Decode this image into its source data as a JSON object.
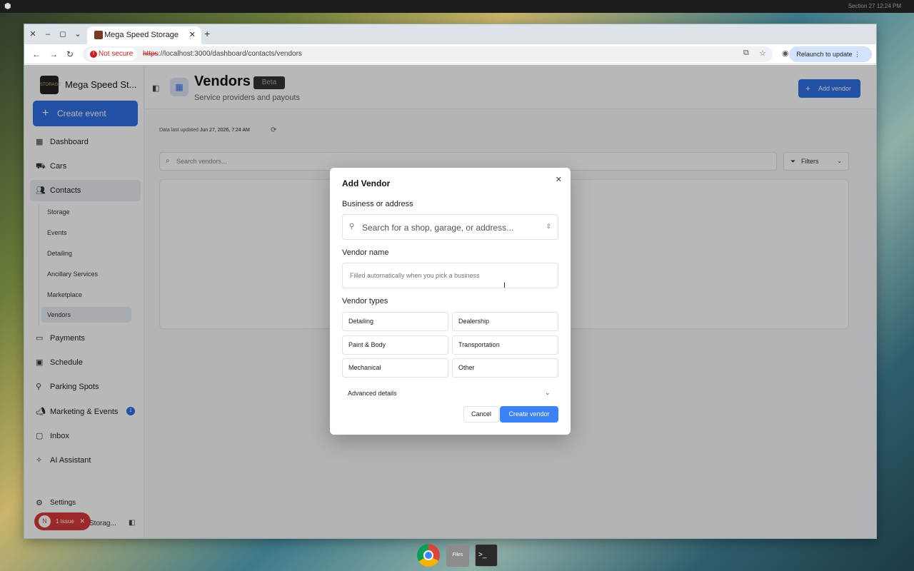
{
  "desktop": {
    "clock": "Section 27 12:24 PM"
  },
  "browser": {
    "tab_title": "Mega Speed Storage",
    "security_label": "Not secure",
    "url_scheme": "https",
    "url_rest": "://localhost:3000/dashboard/contacts/vendors",
    "relaunch_label": "Relaunch to update"
  },
  "sidebar": {
    "brand_name": "Mega Speed St...",
    "brand_logo_text": "STORAGE",
    "create_event_label": "Create event",
    "items": [
      {
        "label": "Dashboard"
      },
      {
        "label": "Cars"
      },
      {
        "label": "Contacts"
      },
      {
        "label": "Payments"
      },
      {
        "label": "Schedule"
      },
      {
        "label": "Parking Spots"
      },
      {
        "label": "Marketing & Events",
        "badge": "1"
      },
      {
        "label": "Inbox"
      },
      {
        "label": "AI Assistant"
      },
      {
        "label": "Settings"
      }
    ],
    "contacts_sub": [
      "Storage",
      "Events",
      "Detailing",
      "Ancillary Services",
      "Marketplace",
      "Vendors"
    ],
    "footer_text": "Storag...",
    "issue": {
      "letter": "N",
      "label": "1 Issue"
    }
  },
  "header": {
    "title": "Vendors",
    "badge": "Beta",
    "subtitle": "Service providers and payouts",
    "add_vendor_label": "Add vendor"
  },
  "content": {
    "last_updated_prefix": "Data last updated",
    "last_updated_value": "Jun 27, 2026, 7:24 AM",
    "search_placeholder": "Search vendors...",
    "filters_label": "Filters"
  },
  "modal": {
    "title": "Add Vendor",
    "business_label": "Business or address",
    "business_placeholder": "Search for a shop, garage, or address...",
    "vendor_name_label": "Vendor name",
    "vendor_name_placeholder": "Filled automatically when you pick a business",
    "vendor_types_label": "Vendor types",
    "vendor_types": [
      "Detailing",
      "Dealership",
      "Paint & Body",
      "Transportation",
      "Mechanical",
      "Other"
    ],
    "advanced_label": "Advanced details",
    "cancel_label": "Cancel",
    "create_label": "Create vendor"
  },
  "dock": {
    "files_label": "Files"
  }
}
